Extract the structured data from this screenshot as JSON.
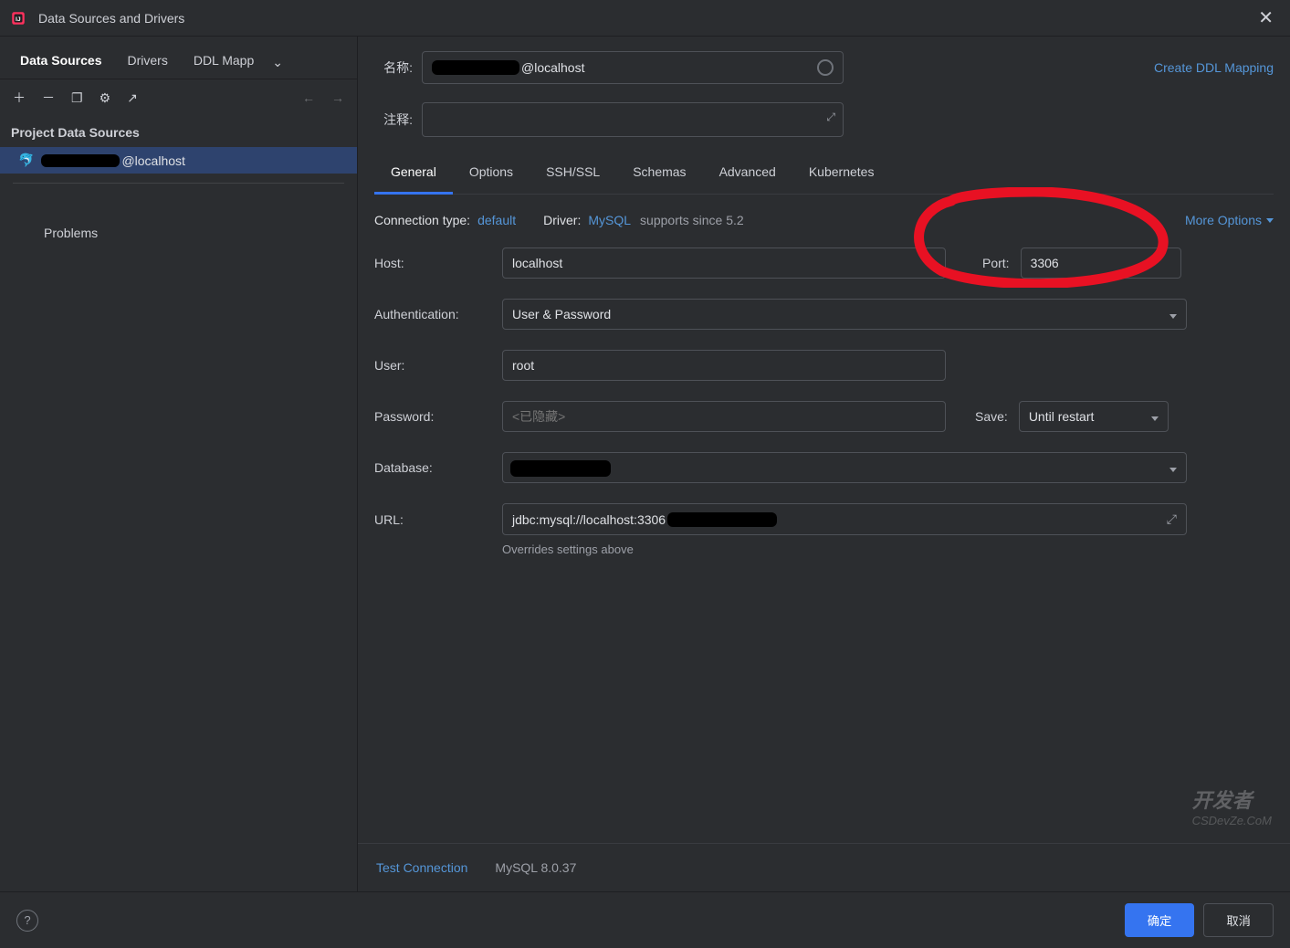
{
  "window": {
    "title": "Data Sources and Drivers"
  },
  "sidebar": {
    "tabs": [
      "Data Sources",
      "Drivers",
      "DDL Mapp"
    ],
    "section": "Project Data Sources",
    "items": [
      {
        "label": "@localhost"
      }
    ],
    "problems": "Problems"
  },
  "header": {
    "name_label": "名称:",
    "name_value": "@localhost",
    "comment_label": "注释:",
    "ddl_link": "Create DDL Mapping"
  },
  "detail_tabs": [
    "General",
    "Options",
    "SSH/SSL",
    "Schemas",
    "Advanced",
    "Kubernetes"
  ],
  "conn": {
    "type_label": "Connection type:",
    "type_value": "default",
    "driver_label": "Driver:",
    "driver_value": "MySQL",
    "driver_hint": "supports since 5.2",
    "more": "More Options"
  },
  "form": {
    "host_label": "Host:",
    "host": "localhost",
    "port_label": "Port:",
    "port": "3306",
    "auth_label": "Authentication:",
    "auth": "User & Password",
    "user_label": "User:",
    "user": "root",
    "pw_label": "Password:",
    "pw_placeholder": "<已隐藏>",
    "save_label": "Save:",
    "save": "Until restart",
    "db_label": "Database:",
    "db": "",
    "url_label": "URL:",
    "url": "jdbc:mysql://localhost:3306",
    "override": "Overrides settings above"
  },
  "footer": {
    "test": "Test Connection",
    "version": "MySQL 8.0.37"
  },
  "buttons": {
    "ok": "确定",
    "cancel": "取消"
  },
  "watermark": {
    "line1": "开发者",
    "line2": "CSDevZe.CoM"
  }
}
